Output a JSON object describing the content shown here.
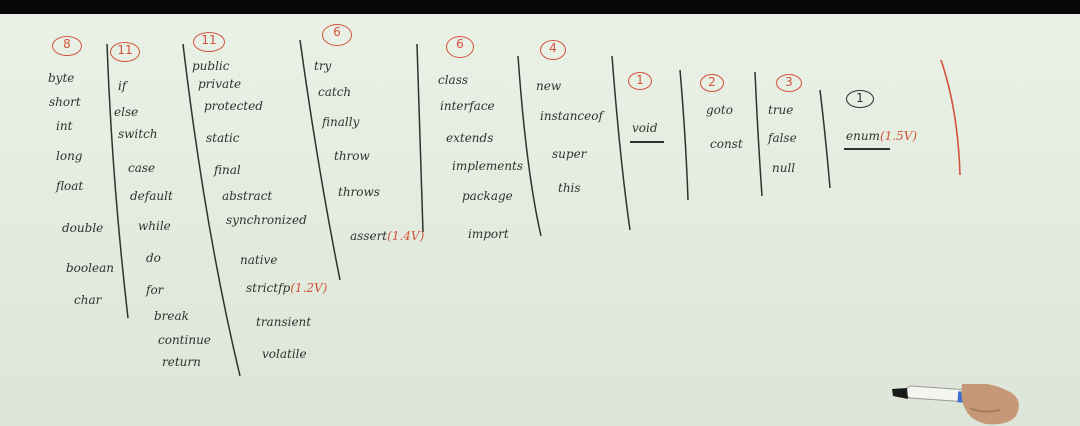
{
  "colors": {
    "board": "#e6ede2",
    "ink": "#2d332f",
    "red_ink": "#d3523d"
  },
  "columns": [
    {
      "count": "8",
      "keywords": [
        "byte",
        "short",
        "int",
        "long",
        "float",
        "double",
        "boolean",
        "char"
      ]
    },
    {
      "count": "11",
      "keywords": [
        "if",
        "else",
        "switch",
        "case",
        "default",
        "while",
        "do",
        "for",
        "break",
        "continue",
        "return"
      ]
    },
    {
      "count": "11",
      "keywords": [
        "public",
        "private",
        "protected",
        "static",
        "final",
        "abstract",
        "synchronized",
        "native",
        "strictfp",
        "transient",
        "volatile"
      ],
      "notes": {
        "strictfp": "(1.2V)"
      }
    },
    {
      "count": "6",
      "keywords": [
        "try",
        "catch",
        "finally",
        "throw",
        "throws",
        "assert"
      ],
      "notes": {
        "assert": "(1.4V)"
      }
    },
    {
      "count": "6",
      "keywords": [
        "class",
        "interface",
        "extends",
        "implements",
        "package",
        "import"
      ]
    },
    {
      "count": "4",
      "keywords": [
        "new",
        "instanceof",
        "super",
        "this"
      ]
    },
    {
      "count": "1",
      "keywords": [
        "void"
      ]
    },
    {
      "count": "2",
      "keywords": [
        "goto",
        "const"
      ]
    },
    {
      "count": "3",
      "keywords": [
        "true",
        "false",
        "null"
      ]
    },
    {
      "count": "1",
      "keywords": [
        "enum"
      ],
      "notes": {
        "enum": "(1.5V)"
      }
    }
  ]
}
